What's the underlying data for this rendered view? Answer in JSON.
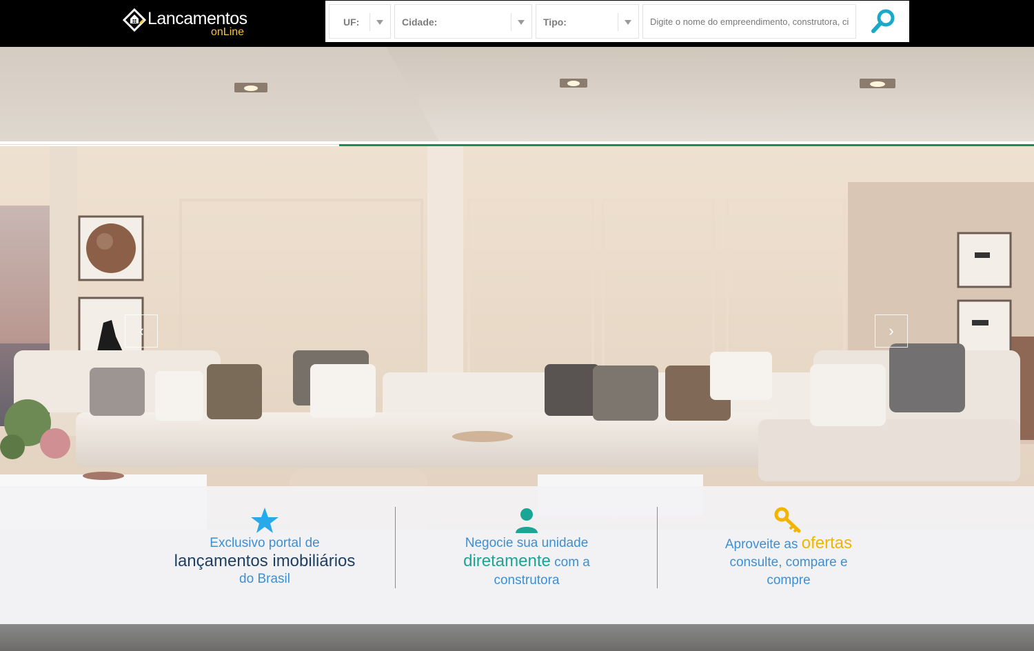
{
  "header": {
    "logo": {
      "name": "Lancamentos",
      "sub": "onLine"
    },
    "search": {
      "uf_label": "UF:",
      "cidade_label": "Cidade:",
      "tipo_label": "Tipo:",
      "placeholder": "Digite o nome do empreendimento, construtora, ci"
    }
  },
  "hero": {
    "prev_label": "‹",
    "next_label": "›"
  },
  "features": [
    {
      "line1": "Exclusivo portal de",
      "highlight": "lançamentos imobiliários",
      "line3": "do Brasil",
      "icon": "star-icon",
      "color": "#29a8ea"
    },
    {
      "line1": "Negocie sua unidade",
      "highlight": "diretamente",
      "after": " com a",
      "line3": "construtora",
      "icon": "user-icon",
      "color": "#1aa594"
    },
    {
      "line1": "Aproveite as ",
      "highlight": "ofertas",
      "line2": "consulte, compare e",
      "line3": "compre",
      "icon": "key-icon",
      "color": "#f2b400"
    }
  ],
  "colors": {
    "topbar": "#000000",
    "accent_blue": "#3c8fd5",
    "search_icon": "#1aa9c9",
    "logo_gold": "#f5c43a"
  }
}
